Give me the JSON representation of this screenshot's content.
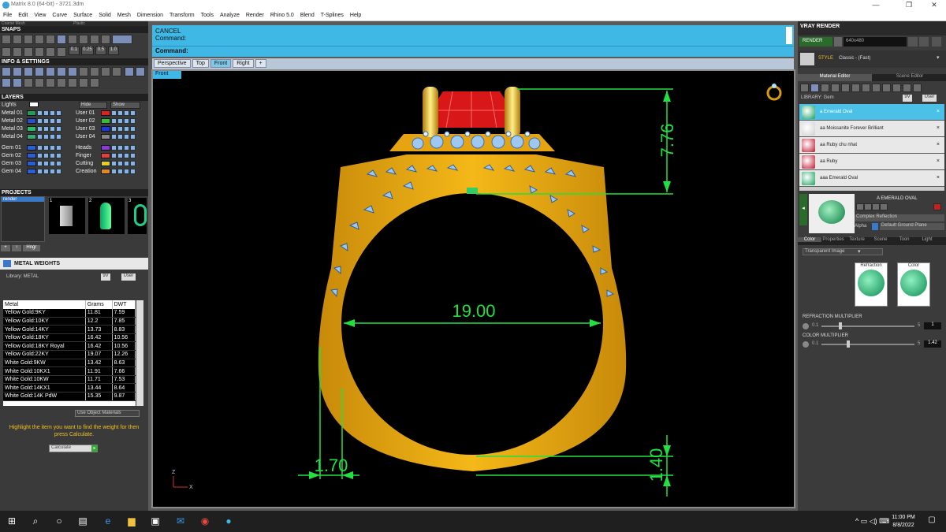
{
  "window": {
    "title": "Matrix 8.0 (64-bit) - 3721.3dm",
    "buttons": [
      "—",
      "❐",
      "✕"
    ]
  },
  "menu": [
    "File",
    "Edit",
    "View",
    "Curve",
    "Surface",
    "Solid",
    "Mesh",
    "Dimension",
    "Transform",
    "Tools",
    "Analyze",
    "Render",
    "Rhino 5.0",
    "Blend",
    "T-Splines",
    "Help"
  ],
  "left": {
    "top_fields": [
      "Coarse Mesh",
      "Plastic"
    ],
    "snaps_title": "SNAPS",
    "snap_values": [
      "0.1",
      "0.25",
      "0.5",
      "1.0"
    ],
    "info_title": "INFO & SETTINGS",
    "layers_title": "LAYERS",
    "lights_label": "Lights",
    "hide_label": "Hide",
    "show_label": "Show",
    "layers_left": [
      {
        "name": "Metal 01",
        "color": "#1e9e5a"
      },
      {
        "name": "Metal 02",
        "color": "#2a4fd0"
      },
      {
        "name": "Metal 03",
        "color": "#27c06a"
      },
      {
        "name": "Metal 04",
        "color": "#3aa870"
      },
      {
        "name": "Gem 01",
        "color": "#2a5fd8"
      },
      {
        "name": "Gem 02",
        "color": "#2a5fd8"
      },
      {
        "name": "Gem 03",
        "color": "#2a5fd8"
      },
      {
        "name": "Gem 04",
        "color": "#2a5fd8"
      }
    ],
    "layers_right": [
      {
        "name": "User 01",
        "color": "#e02020"
      },
      {
        "name": "User 02",
        "color": "#30c030"
      },
      {
        "name": "User 03",
        "color": "#1a3ae0"
      },
      {
        "name": "User 04",
        "color": "#888888"
      },
      {
        "name": "Heads",
        "color": "#8a3ad0"
      },
      {
        "name": "Finger",
        "color": "#e04040"
      },
      {
        "name": "Cutting",
        "color": "#e0d020"
      },
      {
        "name": "Creation",
        "color": "#e08a20"
      }
    ],
    "projects_title": "PROJECTS",
    "project_name": "render",
    "project_numbers": [
      "1",
      "2",
      "3"
    ],
    "project_buttons": [
      "+",
      "↑",
      "Hngr"
    ],
    "weights_title": "METAL WEIGHTS",
    "library_label": "Library: METAL",
    "lib_tabs": [
      "9V",
      "User"
    ],
    "table": {
      "headers": [
        "Metal",
        "Grams",
        "DWT"
      ],
      "rows": [
        [
          "Yellow Gold:9KY",
          "11.81",
          "7.59"
        ],
        [
          "Yellow Gold:10KY",
          "12.2",
          "7.85"
        ],
        [
          "Yellow Gold:14KY",
          "13.73",
          "8.83"
        ],
        [
          "Yellow Gold:18KY",
          "16.42",
          "10.56"
        ],
        [
          "Yellow Gold:18KY Royal",
          "16.42",
          "10.56"
        ],
        [
          "Yellow Gold:22KY",
          "19.07",
          "12.26"
        ],
        [
          "White Gold:9KW",
          "13.42",
          "8.63"
        ],
        [
          "White Gold:10KX1",
          "11.91",
          "7.66"
        ],
        [
          "White Gold:10KW",
          "11.71",
          "7.53"
        ],
        [
          "White Gold:14KX1",
          "13.44",
          "8.64"
        ],
        [
          "White Gold:14K PdW",
          "15.35",
          "9.87"
        ]
      ]
    },
    "use_object_material": "Use Object Materials",
    "hint": "Highlight the item you want to find the weight for then press Calculate.",
    "calculate_label": "Calculate"
  },
  "command": {
    "line1": "CANCEL",
    "line2": "Command:",
    "prompt": "Command:"
  },
  "view_tabs": [
    "Perspective",
    "Top",
    "Front",
    "Right",
    "+"
  ],
  "active_view": "Front",
  "view_label": "Front",
  "dimensions": {
    "top_height": "7.76",
    "inner_diameter": "19.00",
    "shank_width": "1.70",
    "shank_thickness": "1.40"
  },
  "axis": {
    "z": "Z",
    "x": "X"
  },
  "colors": {
    "gold": "#e8a812",
    "gold_dark": "#c98a08",
    "dim_green": "#22e040",
    "ruby": "#d81818",
    "cmd_blue": "#3fb8e6"
  },
  "right": {
    "title": "VRAY RENDER",
    "render_label": "RENDER",
    "resolution": "640x480",
    "style_label": "STYLE",
    "style_value": "Classic - (Fast)",
    "tabs": [
      "Material Editor",
      "Scene Editor"
    ],
    "library_label": "LIBRARY: Gem",
    "lib_tabs": [
      "9V",
      "User"
    ],
    "materials": [
      {
        "name": "a Emerald Oval",
        "color": "#1aa060",
        "selected": true
      },
      {
        "name": "aa Moissanite Forever Brilliant",
        "color": "#cfcfcf",
        "selected": false
      },
      {
        "name": "aa Ruby chu nhat",
        "color": "#c01830",
        "selected": false
      },
      {
        "name": "aa Ruby",
        "color": "#c01830",
        "selected": false
      },
      {
        "name": "aaa Emerald Oval",
        "color": "#1aa060",
        "selected": false
      }
    ],
    "preview_name": "A EMERALD OVAL",
    "reflection_label": "Complex Reflection",
    "alpha_label": "Alpha",
    "ground_label": "Default Ground Plane",
    "prop_tabs": [
      "Color",
      "Properties",
      "Texture",
      "Scene",
      "Toon",
      "Light"
    ],
    "type_value": "Transparent Image",
    "refraction_label": "Refraction",
    "color_label": "Color",
    "refraction_mult_label": "REFRACTION MULTIPLIER",
    "refraction_min": "0.1",
    "refraction_max": "5",
    "refraction_value": "1",
    "color_mult_label": "COLOR MULTIPLIER",
    "color_min": "0.1",
    "color_max": "5",
    "color_value": "1.42"
  },
  "taskbar": {
    "time": "11:00 PM",
    "date": "8/8/2022",
    "icons": [
      "windows-start-icon",
      "search-icon",
      "task-view-icon",
      "widgets-icon",
      "edge-icon",
      "file-explorer-icon",
      "store-icon",
      "mail-icon",
      "chrome-icon",
      "matrix-app-icon"
    ]
  }
}
